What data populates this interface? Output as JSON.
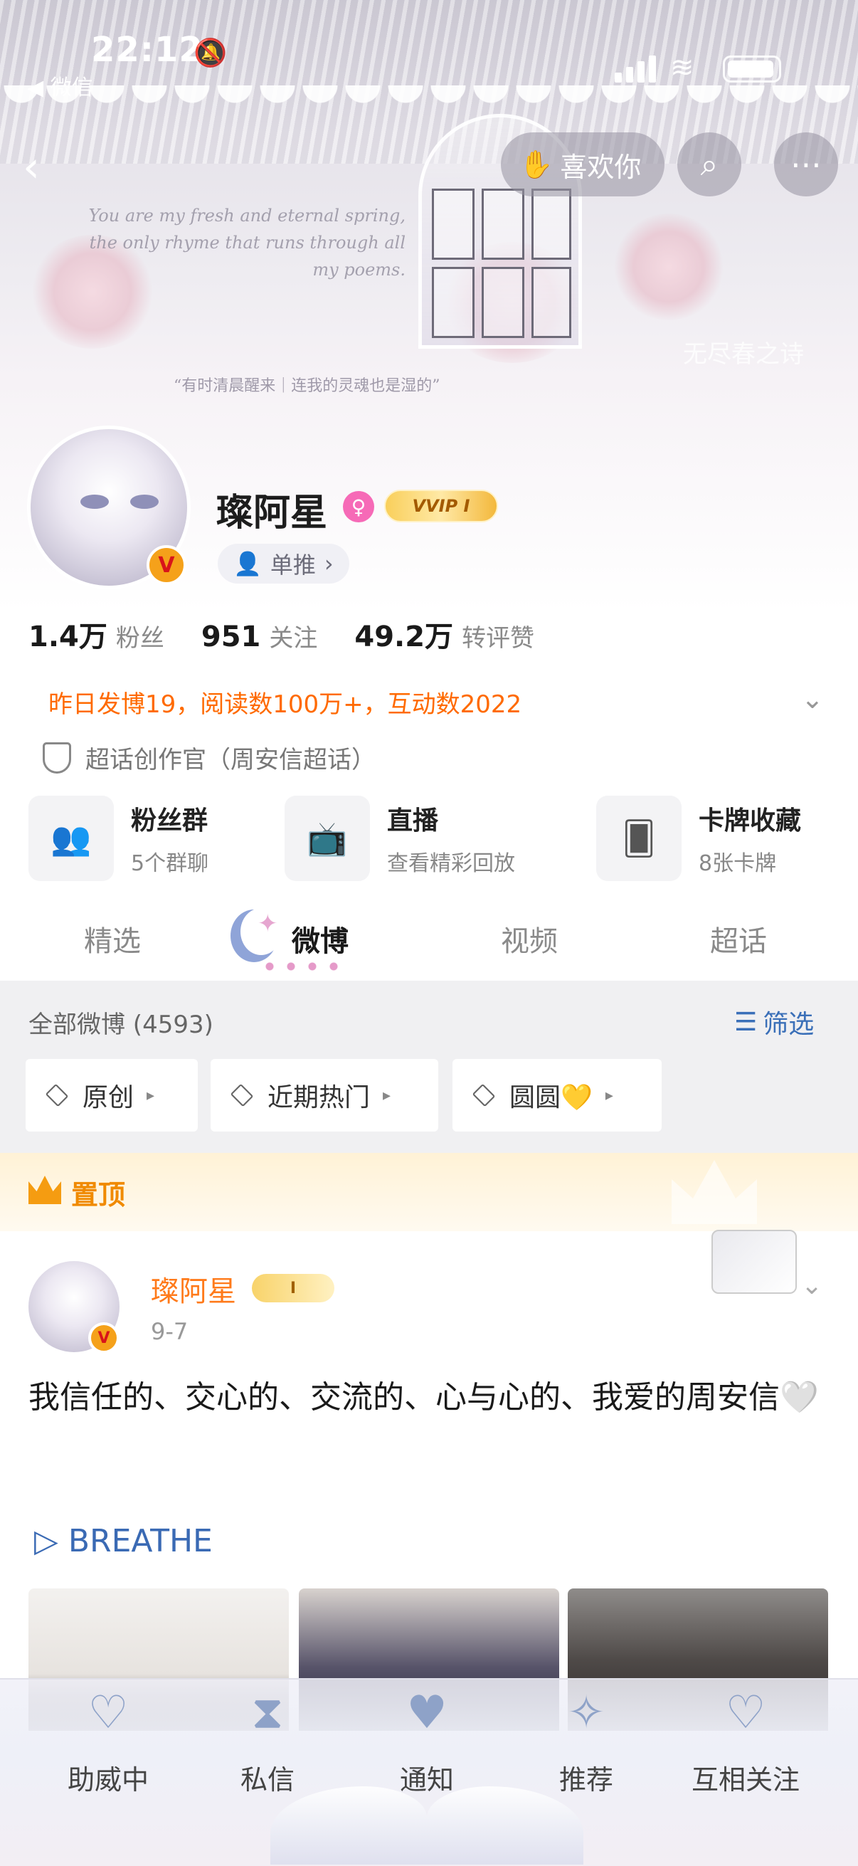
{
  "status_bar": {
    "time": "22:12",
    "back_app": "◀ 微信"
  },
  "banner": {
    "english_quote": "You are my fresh and eternal spring, the only rhyme that runs through all my poems.",
    "chinese_quote": "“有时清晨醒来｜连我的灵魂也是湿的”",
    "signature": "无尽春之诗",
    "like_button": "喜欢你"
  },
  "profile": {
    "username": "璨阿星",
    "vip_badge": "VVIP Ⅰ",
    "single_push": "单推",
    "stats": [
      {
        "value": "1.4万",
        "label": "粉丝"
      },
      {
        "value": "951",
        "label": "关注"
      },
      {
        "value": "49.2万",
        "label": "转评赞"
      }
    ],
    "notice": "昨日发博19，阅读数100万+，互动数2022",
    "role": "超话创作官（周安信超话）"
  },
  "quick_links": [
    {
      "title": "粉丝群",
      "sub": "5个群聊",
      "icon": "people-icon"
    },
    {
      "title": "直播",
      "sub": "查看精彩回放",
      "icon": "tv-icon"
    },
    {
      "title": "卡牌收藏",
      "sub": "8张卡牌",
      "icon": "card-icon"
    }
  ],
  "tabs": [
    "精选",
    "微博",
    "视频",
    "超话"
  ],
  "active_tab": "微博",
  "feed": {
    "all_weibo": "全部微博 (4593)",
    "filter": "筛选",
    "chips": [
      "原创",
      "近期热门",
      "圆圆💛"
    ],
    "pinned_label": "置顶"
  },
  "post": {
    "name": "璨阿星",
    "badge": "Ⅰ",
    "date": "9-7",
    "text": "我信任的、交心的、交流的、心与心的、我爱的周安信🤍",
    "link": "▷ BREATHE"
  },
  "bottom_tabs": [
    "助威中",
    "私信",
    "通知",
    "推荐",
    "互相关注"
  ],
  "colors": {
    "accent": "#ff6a00",
    "link": "#3a6ab4",
    "vip_gold": "#f9cf5b"
  }
}
